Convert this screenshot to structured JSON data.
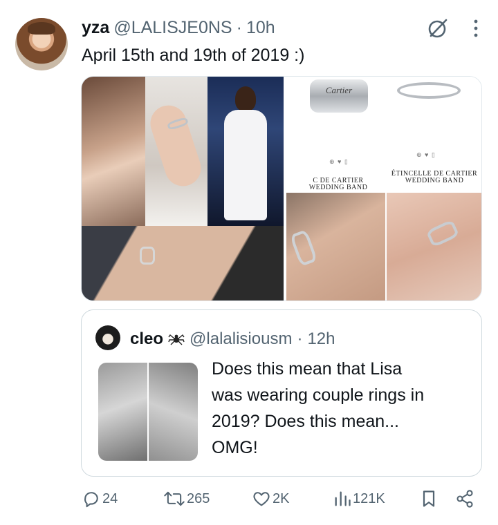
{
  "tweet": {
    "name": "yza",
    "handle": "@LALISJE0NS",
    "dot": "·",
    "time": "10h",
    "text": "April 15th and 19th of 2019 :)",
    "media": {
      "brand_text": "Cartier",
      "product_1_label": "C DE CARTIER WEDDING BAND",
      "product_2_label": "ÉTINCELLE DE CARTIER WEDDING BAND"
    }
  },
  "quote": {
    "name": "cleo",
    "handle": "@lalalisiousm",
    "dot": "·",
    "time": "12h",
    "text": "Does this mean that Lisa\nwas wearing couple rings in\n2019? Does this mean...\nOMG!"
  },
  "actions": {
    "replies": "24",
    "retweets": "265",
    "likes": "2K",
    "views": "121K"
  },
  "colors": {
    "text": "#0f1419",
    "secondary": "#536471",
    "border": "#cfd9de"
  },
  "icons": [
    "grok-icon",
    "more-icon",
    "spider-icon",
    "reply-icon",
    "retweet-icon",
    "like-icon",
    "views-icon",
    "bookmark-icon",
    "share-icon"
  ]
}
